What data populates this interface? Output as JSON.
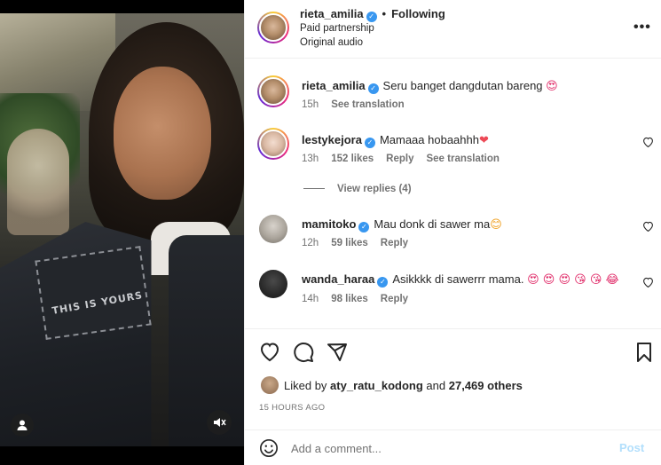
{
  "post": {
    "username": "rieta_amilia",
    "follow_status": "Following",
    "subtitle": "Paid partnership",
    "audio": "Original audio",
    "more_icon": "more-horizontal-icon"
  },
  "media": {
    "patch_text": "THIS IS YOURS",
    "user_tag_icon": "user-icon",
    "mute_icon": "muted-speaker-icon"
  },
  "comments": [
    {
      "username": "rieta_amilia",
      "verified": true,
      "text": "Seru banget dangdutan bareng",
      "emoji": "😍",
      "time": "15h",
      "translation": "See translation"
    },
    {
      "username": "lestykejora",
      "verified": true,
      "text": "Mamaaa hobaahhh",
      "emoji": "❤",
      "time": "13h",
      "likes": "152 likes",
      "reply": "Reply",
      "translation": "See translation",
      "view_replies": "View replies (4)"
    },
    {
      "username": "mamitoko",
      "verified": true,
      "text": "Mau donk di sawer ma",
      "emoji": "😊",
      "time": "12h",
      "likes": "59 likes",
      "reply": "Reply"
    },
    {
      "username": "wanda_haraa",
      "verified": true,
      "text": "Asikkkk di sawerrr mama.",
      "emoji": "😍 😍 😍 😘 😘 😂",
      "time": "14h",
      "likes": "98 likes",
      "reply": "Reply"
    }
  ],
  "actions": {
    "like_icon": "heart-icon",
    "comment_icon": "comment-icon",
    "share_icon": "share-icon",
    "save_icon": "bookmark-icon"
  },
  "likes": {
    "prefix": "Liked by",
    "user": "aty_ratu_kodong",
    "conjunction": "and",
    "others": "27,469 others"
  },
  "timestamp": "15 HOURS AGO",
  "add_comment": {
    "placeholder": "Add a comment...",
    "post_label": "Post",
    "emoji_icon": "emoji-smile-icon"
  },
  "colors": {
    "verified": "#3897f0",
    "post_disabled": "#b2dffc",
    "meta_text": "#737373"
  }
}
